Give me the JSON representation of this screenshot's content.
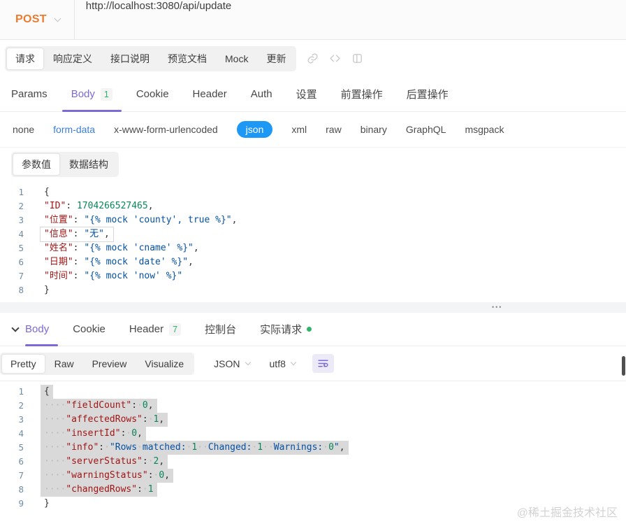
{
  "colors": {
    "method_orange": "#ED7B2F",
    "accent_purple": "#7C6AD8",
    "success_green": "#2FB56B",
    "json_pill_blue": "#1E98F5",
    "link_blue": "#3C7EDB",
    "code_key": "#A31515",
    "code_string": "#0451A5",
    "code_number": "#098658"
  },
  "url_bar": {
    "method": "POST",
    "url": "http://localhost:3080/api/update"
  },
  "doc_tabs": {
    "items": [
      {
        "label": "请求",
        "active": true
      },
      {
        "label": "响应定义"
      },
      {
        "label": "接口说明"
      },
      {
        "label": "预览文档"
      },
      {
        "label": "Mock"
      },
      {
        "label": "更新"
      }
    ],
    "icons": [
      "link-icon",
      "code-icon",
      "split-panel-icon"
    ]
  },
  "request_tabs": {
    "items": [
      {
        "label": "Params"
      },
      {
        "label": "Body",
        "badge": "1",
        "active": true
      },
      {
        "label": "Cookie"
      },
      {
        "label": "Header"
      },
      {
        "label": "Auth"
      },
      {
        "label": "设置"
      },
      {
        "label": "前置操作"
      },
      {
        "label": "后置操作"
      }
    ]
  },
  "body_types": {
    "items": [
      {
        "label": "none"
      },
      {
        "label": "form-data",
        "highlight": true
      },
      {
        "label": "x-www-form-urlencoded"
      },
      {
        "label": "json",
        "selected": true
      },
      {
        "label": "xml"
      },
      {
        "label": "raw"
      },
      {
        "label": "binary"
      },
      {
        "label": "GraphQL"
      },
      {
        "label": "msgpack"
      }
    ]
  },
  "param_mode": {
    "items": [
      {
        "label": "参数值",
        "active": true
      },
      {
        "label": "数据结构"
      }
    ]
  },
  "request_editor": {
    "lines": [
      {
        "n": 1,
        "tokens": [
          {
            "t": "p",
            "v": "{"
          }
        ]
      },
      {
        "n": 2,
        "tokens": [
          {
            "t": "key",
            "v": "\"ID\""
          },
          {
            "t": "p",
            "v": ": "
          },
          {
            "t": "num",
            "v": "1704266527465"
          },
          {
            "t": "p",
            "v": ","
          }
        ]
      },
      {
        "n": 3,
        "tokens": [
          {
            "t": "key",
            "v": "\"位置\""
          },
          {
            "t": "p",
            "v": ": "
          },
          {
            "t": "str",
            "v": "\"{% mock 'county', true %}\""
          },
          {
            "t": "p",
            "v": ","
          }
        ]
      },
      {
        "n": 4,
        "boxed": true,
        "tokens": [
          {
            "t": "key",
            "v": "\"信息\""
          },
          {
            "t": "p",
            "v": ": "
          },
          {
            "t": "str",
            "v": "\"无\""
          },
          {
            "t": "p",
            "v": ","
          }
        ]
      },
      {
        "n": 5,
        "tokens": [
          {
            "t": "key",
            "v": "\"姓名\""
          },
          {
            "t": "p",
            "v": ": "
          },
          {
            "t": "str",
            "v": "\"{% mock 'cname' %}\""
          },
          {
            "t": "p",
            "v": ","
          }
        ]
      },
      {
        "n": 6,
        "tokens": [
          {
            "t": "key",
            "v": "\"日期\""
          },
          {
            "t": "p",
            "v": ": "
          },
          {
            "t": "str",
            "v": "\"{% mock 'date' %}\""
          },
          {
            "t": "p",
            "v": ","
          }
        ]
      },
      {
        "n": 7,
        "tokens": [
          {
            "t": "key",
            "v": "\"时间\""
          },
          {
            "t": "p",
            "v": ": "
          },
          {
            "t": "str",
            "v": "\"{% mock 'now' %}\""
          }
        ]
      },
      {
        "n": 8,
        "tokens": [
          {
            "t": "p",
            "v": "}"
          }
        ]
      }
    ]
  },
  "splitter": {
    "handle": "•••"
  },
  "response_tabs": {
    "items": [
      {
        "label": "Body",
        "active": true
      },
      {
        "label": "Cookie"
      },
      {
        "label": "Header",
        "badge": "7"
      },
      {
        "label": "控制台"
      },
      {
        "label": "实际请求",
        "dot": true
      }
    ]
  },
  "response_toolbar": {
    "views": [
      {
        "label": "Pretty",
        "active": true
      },
      {
        "label": "Raw"
      },
      {
        "label": "Preview"
      },
      {
        "label": "Visualize"
      }
    ],
    "format": "JSON",
    "encoding": "utf8"
  },
  "response_editor": {
    "lines": [
      {
        "n": 1,
        "sel": true,
        "tokens": [
          {
            "t": "p",
            "v": "{"
          }
        ]
      },
      {
        "n": 2,
        "sel": true,
        "tokens": [
          {
            "t": "ws",
            "v": 4
          },
          {
            "t": "key",
            "v": "\"fieldCount\""
          },
          {
            "t": "p",
            "v": ":"
          },
          {
            "t": "ws",
            "v": 1
          },
          {
            "t": "num",
            "v": "0"
          },
          {
            "t": "p",
            "v": ","
          }
        ]
      },
      {
        "n": 3,
        "sel": true,
        "tokens": [
          {
            "t": "ws",
            "v": 4
          },
          {
            "t": "key",
            "v": "\"affectedRows\""
          },
          {
            "t": "p",
            "v": ":"
          },
          {
            "t": "ws",
            "v": 1
          },
          {
            "t": "num",
            "v": "1"
          },
          {
            "t": "p",
            "v": ","
          }
        ]
      },
      {
        "n": 4,
        "sel": true,
        "tokens": [
          {
            "t": "ws",
            "v": 4
          },
          {
            "t": "key",
            "v": "\"insertId\""
          },
          {
            "t": "p",
            "v": ":"
          },
          {
            "t": "ws",
            "v": 1
          },
          {
            "t": "num",
            "v": "0"
          },
          {
            "t": "p",
            "v": ","
          }
        ]
      },
      {
        "n": 5,
        "sel": true,
        "tokens": [
          {
            "t": "ws",
            "v": 4
          },
          {
            "t": "key",
            "v": "\"info\""
          },
          {
            "t": "p",
            "v": ":"
          },
          {
            "t": "ws",
            "v": 1
          },
          {
            "t": "str",
            "v": "\"Rows matched: "
          },
          {
            "t": "num",
            "v": "1"
          },
          {
            "t": "str",
            "v": "  Changed: "
          },
          {
            "t": "num",
            "v": "1"
          },
          {
            "t": "str",
            "v": "  Warnings: "
          },
          {
            "t": "num",
            "v": "0"
          },
          {
            "t": "str",
            "v": "\""
          },
          {
            "t": "p",
            "v": ","
          }
        ]
      },
      {
        "n": 6,
        "sel": true,
        "tokens": [
          {
            "t": "ws",
            "v": 4
          },
          {
            "t": "key",
            "v": "\"serverStatus\""
          },
          {
            "t": "p",
            "v": ":"
          },
          {
            "t": "ws",
            "v": 1
          },
          {
            "t": "num",
            "v": "2"
          },
          {
            "t": "p",
            "v": ","
          }
        ]
      },
      {
        "n": 7,
        "sel": true,
        "tokens": [
          {
            "t": "ws",
            "v": 4
          },
          {
            "t": "key",
            "v": "\"warningStatus\""
          },
          {
            "t": "p",
            "v": ":"
          },
          {
            "t": "ws",
            "v": 1
          },
          {
            "t": "num",
            "v": "0"
          },
          {
            "t": "p",
            "v": ","
          }
        ]
      },
      {
        "n": 8,
        "sel": true,
        "tokens": [
          {
            "t": "ws",
            "v": 4
          },
          {
            "t": "key",
            "v": "\"changedRows\""
          },
          {
            "t": "p",
            "v": ":"
          },
          {
            "t": "ws",
            "v": 1
          },
          {
            "t": "num",
            "v": "1"
          }
        ]
      },
      {
        "n": 9,
        "tokens": [
          {
            "t": "p",
            "v": "}"
          }
        ]
      }
    ]
  },
  "watermark": "@稀土掘金技术社区"
}
